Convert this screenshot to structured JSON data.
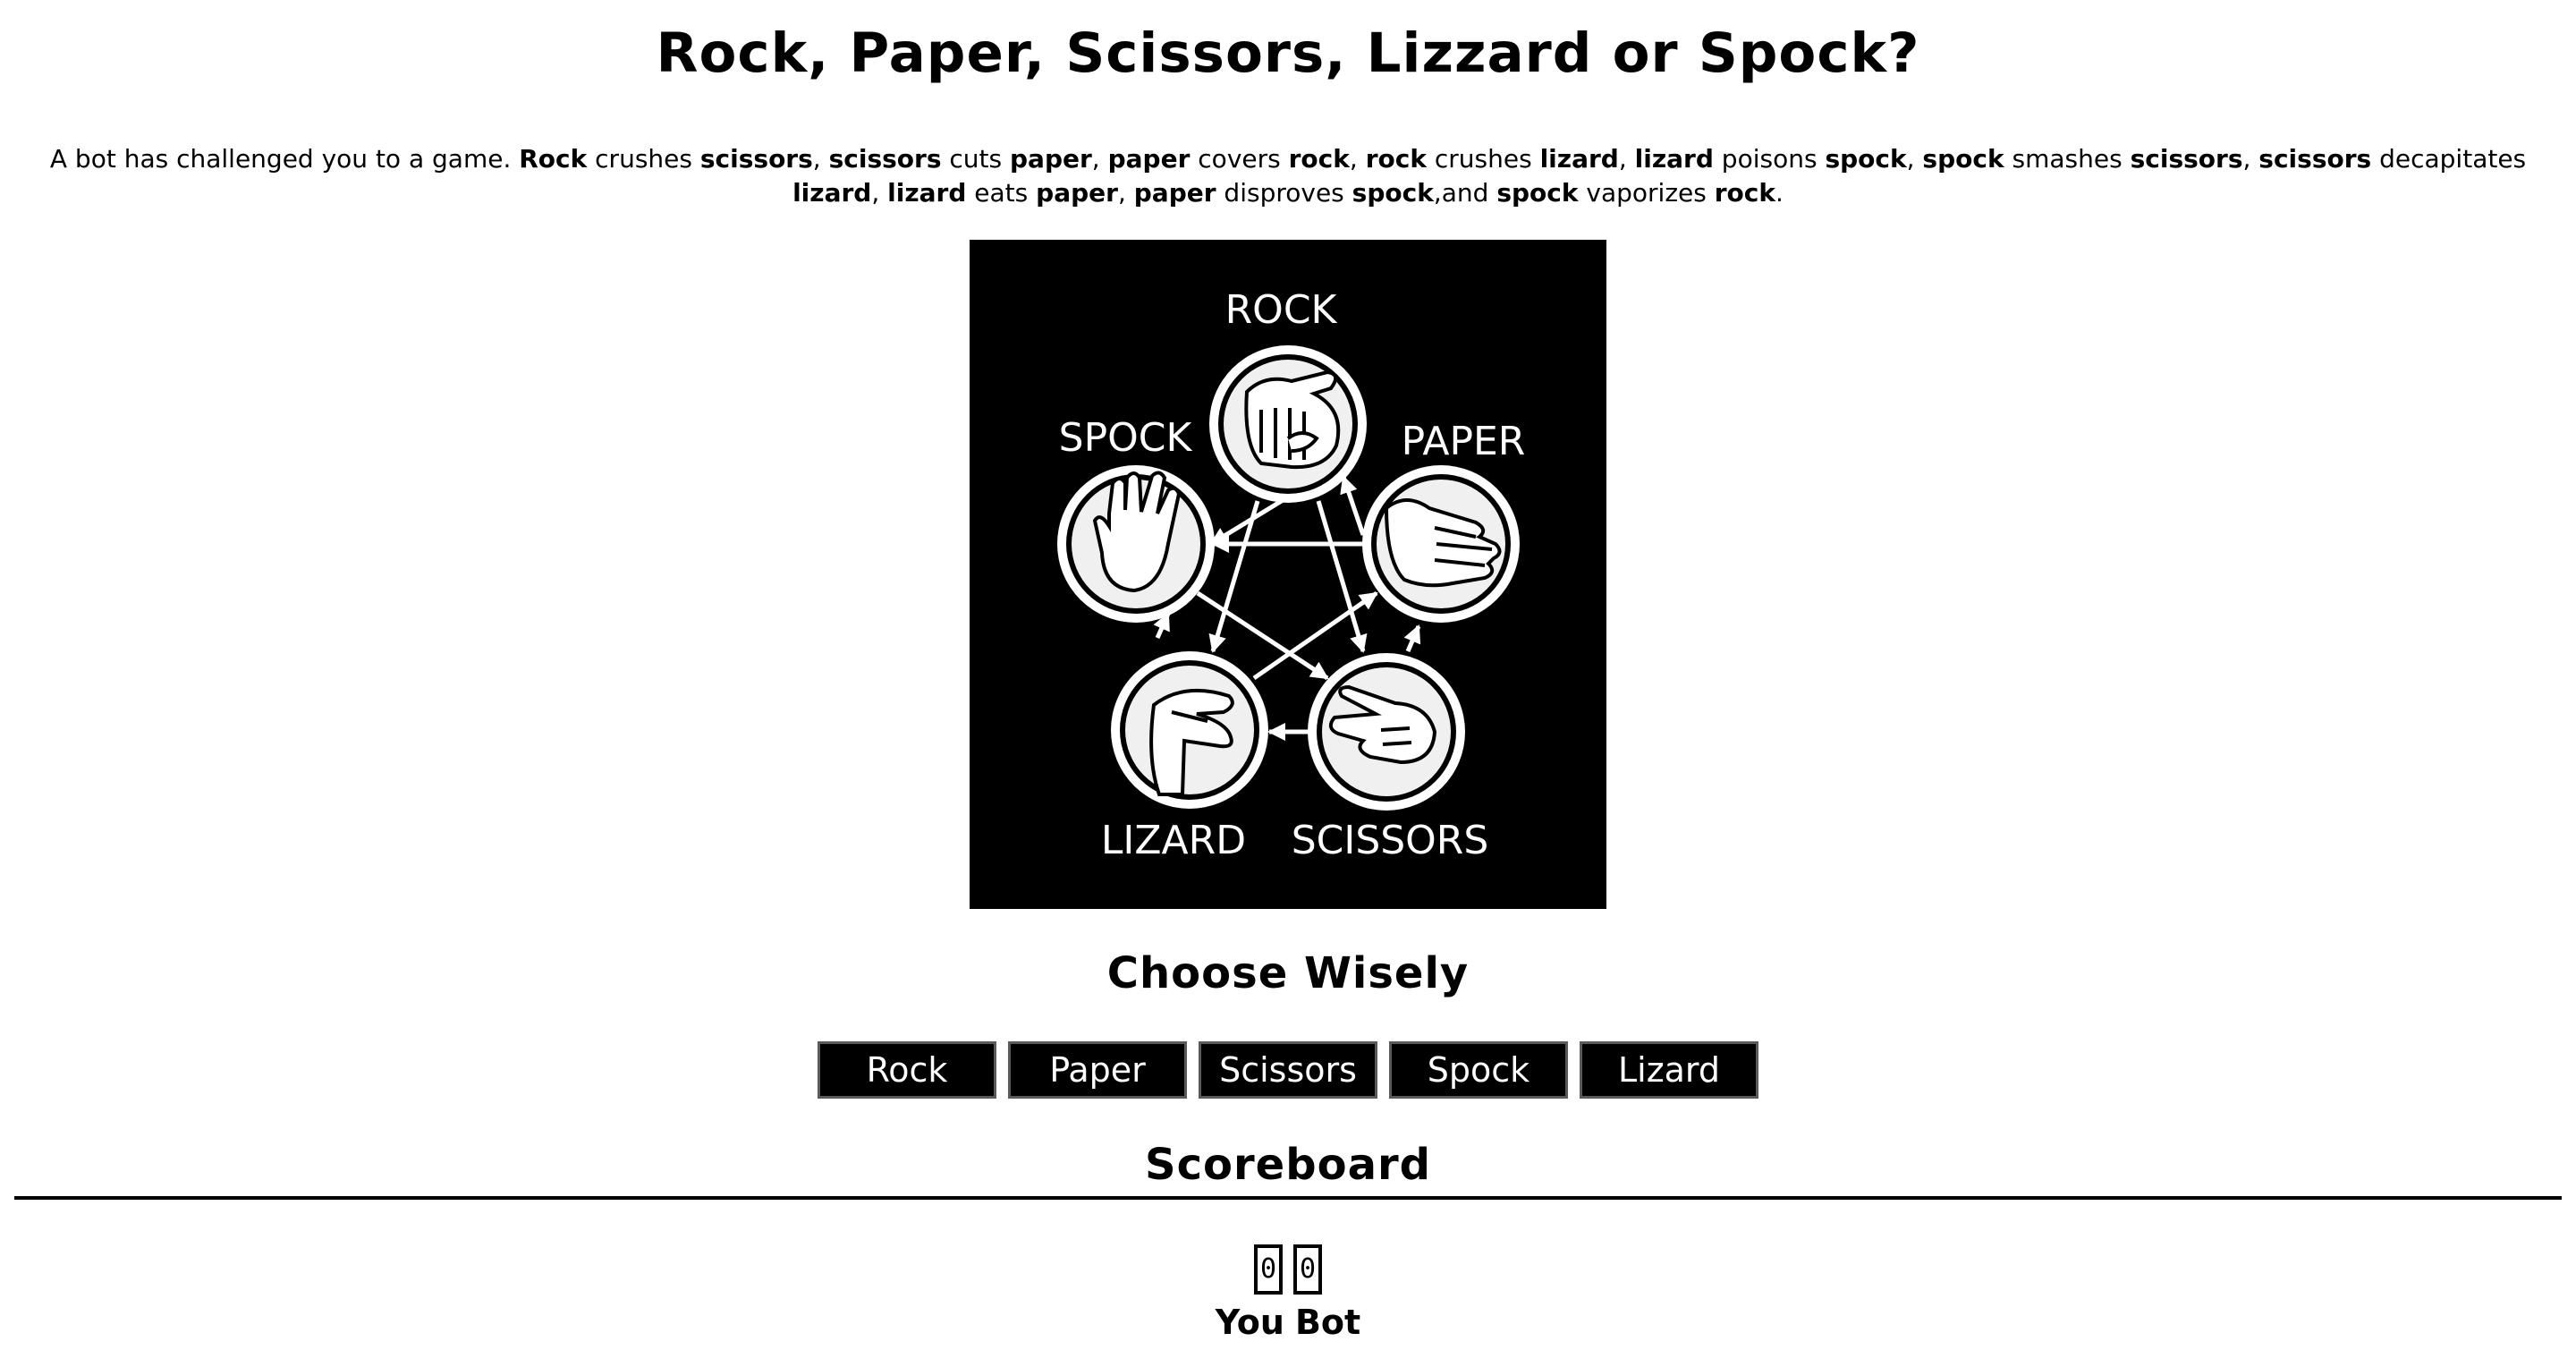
{
  "title": "Rock, Paper, Scissors, Lizzard or Spock?",
  "intro": {
    "lead": "A bot has challenged you to a game. ",
    "segments": [
      {
        "b": "Rock"
      },
      {
        "t": " crushes "
      },
      {
        "b": "scissors"
      },
      {
        "t": ", "
      },
      {
        "b": "scissors"
      },
      {
        "t": " cuts "
      },
      {
        "b": "paper"
      },
      {
        "t": ", "
      },
      {
        "b": "paper"
      },
      {
        "t": " covers "
      },
      {
        "b": "rock"
      },
      {
        "t": ", "
      },
      {
        "b": "rock"
      },
      {
        "t": " crushes "
      },
      {
        "b": "lizard"
      },
      {
        "t": ", "
      },
      {
        "b": "lizard"
      },
      {
        "t": " poisons "
      },
      {
        "b": "spock"
      },
      {
        "t": ", "
      },
      {
        "b": "spock"
      },
      {
        "t": " smashes "
      },
      {
        "b": "scissors"
      },
      {
        "t": ", "
      },
      {
        "b": "scissors"
      },
      {
        "t": " decapitates "
      },
      {
        "b": "lizard"
      },
      {
        "t": ", "
      },
      {
        "b": "lizard"
      },
      {
        "t": " eats "
      },
      {
        "b": "paper"
      },
      {
        "t": ", "
      },
      {
        "b": "paper"
      },
      {
        "t": " disproves "
      },
      {
        "b": "spock"
      },
      {
        "t": ",and "
      },
      {
        "b": "spock"
      },
      {
        "t": " vaporizes "
      },
      {
        "b": "rock"
      },
      {
        "t": "."
      }
    ]
  },
  "diagram": {
    "labels": {
      "rock": "ROCK",
      "paper": "PAPER",
      "scissors": "SCISSORS",
      "lizard": "LIZARD",
      "spock": "SPOCK"
    },
    "background": "#000000",
    "foreground": "#ffffff",
    "disc": "#f0f0f0"
  },
  "choose_heading": "Choose Wisely",
  "choices": [
    {
      "id": "rock",
      "label": "Rock"
    },
    {
      "id": "paper",
      "label": "Paper"
    },
    {
      "id": "scissors",
      "label": "Scissors"
    },
    {
      "id": "spock",
      "label": "Spock"
    },
    {
      "id": "lizard",
      "label": "Lizard"
    }
  ],
  "scoreboard": {
    "heading": "Scoreboard",
    "you_score": "0",
    "bot_score": "0",
    "you_label": "You",
    "bot_label": "Bot"
  }
}
